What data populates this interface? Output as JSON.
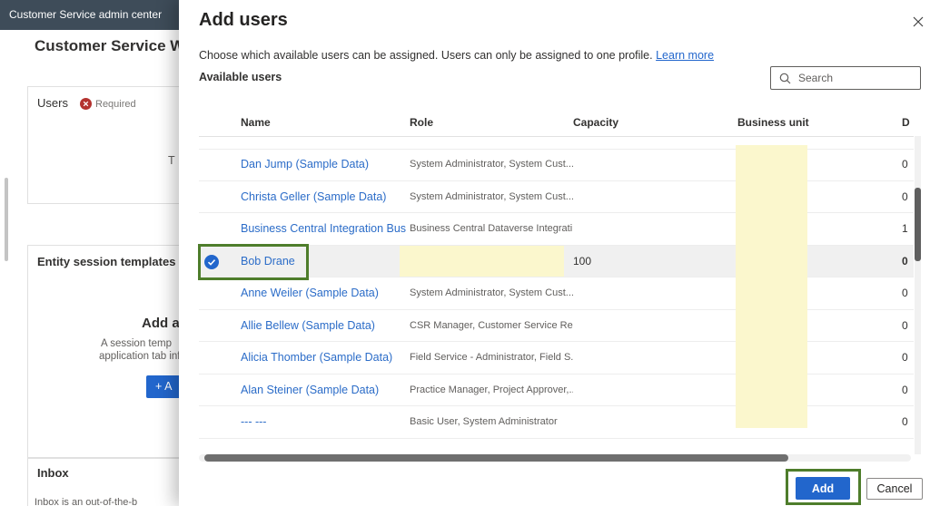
{
  "colors": {
    "accent": "#2266cc",
    "link": "#2b6cc8",
    "highlight": "#fbf7cd",
    "annotation": "#4e7d2b",
    "topbar": "#3e4c59"
  },
  "background": {
    "topbar_title": "Customer Service admin center",
    "page_title": "Customer Service Wo",
    "users_card": {
      "label": "Users",
      "required_label": "Required",
      "clipped_text": "T"
    },
    "entity_card": {
      "title": "Entity session templates",
      "empty_title": "Add a",
      "empty_line1": "A session temp",
      "empty_line2": "application tab inf",
      "add_button_label": "+ A"
    },
    "inbox_card": {
      "title": "Inbox",
      "clipped_text": "Inbox is an out-of-the-b"
    }
  },
  "dialog": {
    "title": "Add users",
    "description": "Choose which available users can be assigned. Users can only be assigned to one profile.",
    "learn_more_label": "Learn more",
    "section_label": "Available users",
    "search_placeholder": "Search",
    "table": {
      "headers": {
        "name": "Name",
        "sort_icon": "↓",
        "role": "Role",
        "capacity": "Capacity",
        "business_unit": "Business unit",
        "last": "D"
      },
      "rows": [
        {
          "name": "Dan Jump (Sample Data)",
          "role": "System Administrator, System Cust...",
          "capacity": "",
          "last": "0",
          "selected": false
        },
        {
          "name": "Christa Geller (Sample Data)",
          "role": "System Administrator, System Cust...",
          "capacity": "",
          "last": "0",
          "selected": false
        },
        {
          "name": "Business Central Integration Busin",
          "role": "Business Central Dataverse Integrati...",
          "capacity": "",
          "last": "1",
          "selected": false
        },
        {
          "name": "Bob Drane",
          "role": "",
          "capacity": "100",
          "last": "0",
          "selected": true
        },
        {
          "name": "Anne Weiler (Sample Data)",
          "role": "System Administrator, System Cust...",
          "capacity": "",
          "last": "0",
          "selected": false
        },
        {
          "name": "Allie Bellew (Sample Data)",
          "role": "CSR Manager, Customer Service Re...",
          "capacity": "",
          "last": "0",
          "selected": false
        },
        {
          "name": "Alicia Thomber (Sample Data)",
          "role": "Field Service - Administrator, Field S...",
          "capacity": "",
          "last": "0",
          "selected": false
        },
        {
          "name": "Alan Steiner (Sample Data)",
          "role": "Practice Manager, Project Approver,...",
          "capacity": "",
          "last": "0",
          "selected": false
        },
        {
          "name": "--- ---",
          "role": "Basic User, System Administrator",
          "capacity": "",
          "last": "0",
          "selected": false
        }
      ]
    },
    "footer": {
      "add_label": "Add",
      "cancel_label": "Cancel"
    }
  }
}
